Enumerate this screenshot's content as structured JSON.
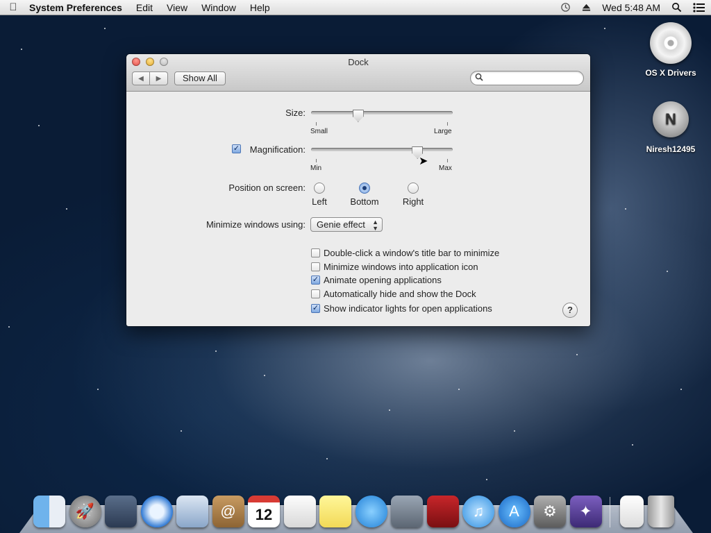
{
  "menubar": {
    "apple_icon": "apple-logo-icon",
    "app_name": "System Preferences",
    "menus": [
      "Edit",
      "View",
      "Window",
      "Help"
    ],
    "clock": "Wed 5:48 AM",
    "status_icons": [
      "time-machine-icon",
      "eject-icon",
      "spotlight-icon",
      "notification-center-icon"
    ]
  },
  "desktop": {
    "icons": [
      {
        "label": "OS X Drivers",
        "icon": "optical-disc-icon"
      },
      {
        "label": "Niresh12495",
        "icon": "network-drive-icon"
      }
    ]
  },
  "window": {
    "title": "Dock",
    "show_all_label": "Show All",
    "search_placeholder": "",
    "size": {
      "label": "Size:",
      "min_label": "Small",
      "max_label": "Large",
      "value": 0.32
    },
    "magnification": {
      "label": "Magnification:",
      "checked": true,
      "min_label": "Min",
      "max_label": "Max",
      "value": 0.77
    },
    "position": {
      "label": "Position on screen:",
      "options": [
        "Left",
        "Bottom",
        "Right"
      ],
      "selected": "Bottom"
    },
    "minimize": {
      "label": "Minimize windows using:",
      "value": "Genie effect"
    },
    "options": [
      {
        "label": "Double-click a window's title bar to minimize",
        "checked": false
      },
      {
        "label": "Minimize windows into application icon",
        "checked": false
      },
      {
        "label": "Animate opening applications",
        "checked": true
      },
      {
        "label": "Automatically hide and show the Dock",
        "checked": false
      },
      {
        "label": "Show indicator lights for open applications",
        "checked": true
      }
    ],
    "help_label": "?"
  },
  "dock": {
    "apps": [
      "finder-icon",
      "launchpad-icon",
      "mission-control-icon",
      "safari-icon",
      "mail-icon",
      "contacts-icon",
      "calendar-icon",
      "reminders-icon",
      "notes-icon",
      "messages-icon",
      "facetime-icon",
      "photo-booth-icon",
      "itunes-icon",
      "app-store-icon",
      "system-preferences-icon",
      "wizard-app-icon"
    ],
    "calendar_day": "12",
    "trailing": [
      "document-stack-icon",
      "trash-icon"
    ]
  }
}
